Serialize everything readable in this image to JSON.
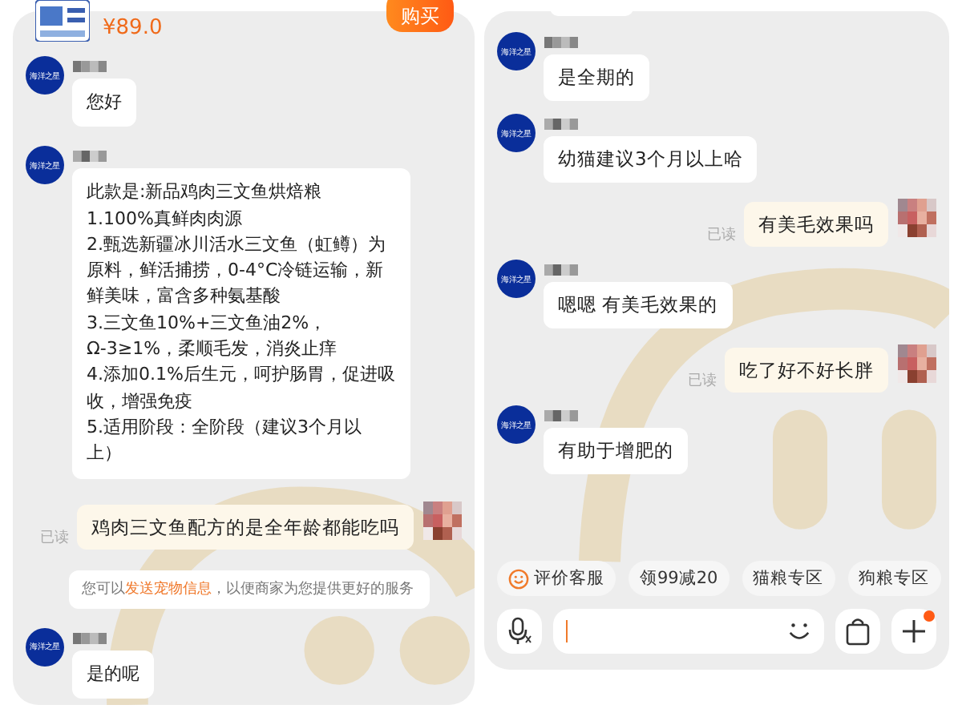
{
  "left_panel": {
    "product": {
      "price": "¥89.0",
      "buy_button": "购买"
    },
    "messages": [
      {
        "kind": "agent",
        "avatar_label": "海洋之星",
        "lines": [
          "您好"
        ]
      },
      {
        "kind": "agent",
        "avatar_label": "海洋之星",
        "lines": [
          "此款是:新品鸡肉三文鱼烘焙粮",
          "1.100%真鲜肉肉源",
          "2.甄选新疆冰川活水三文鱼（虹鳟）为原料，鲜活捕捞，0-4°C冷链运输，新鲜美味，富含多种氨基酸",
          "3.三文鱼10%+三文鱼油2%，Ω-3≥1%，柔顺毛发，消炎止痒",
          "4.添加0.1%后生元，呵护肠胃，促进吸收，增强免疫",
          "5.适用阶段：全阶段（建议3个月以上）"
        ]
      },
      {
        "kind": "user",
        "text": "鸡肉三文鱼配方的是全年龄都能吃吗",
        "status": "已读"
      },
      {
        "kind": "notice",
        "before": "您可以",
        "link": "发送宠物信息",
        "after": "，以便商家为您提供更好的服务"
      },
      {
        "kind": "agent",
        "avatar_label": "海洋之星",
        "lines": [
          "是的呢"
        ]
      }
    ]
  },
  "right_panel": {
    "messages": [
      {
        "kind": "agent",
        "avatar_label": "海洋之星",
        "lines": [
          "是全期的"
        ]
      },
      {
        "kind": "agent",
        "avatar_label": "海洋之星",
        "lines": [
          "幼猫建议3个月以上哈"
        ]
      },
      {
        "kind": "user",
        "text": "有美毛效果吗",
        "status": "已读"
      },
      {
        "kind": "agent",
        "avatar_label": "海洋之星",
        "lines": [
          "嗯嗯 有美毛效果的"
        ]
      },
      {
        "kind": "user",
        "text": "吃了好不好长胖",
        "status": "已读"
      },
      {
        "kind": "agent",
        "avatar_label": "海洋之星",
        "lines": [
          "有助于增肥的"
        ]
      }
    ],
    "quick_replies": [
      {
        "kind": "rating",
        "label": "评价客服"
      },
      {
        "kind": "plain",
        "label": "领99减20"
      },
      {
        "kind": "plain",
        "label": "猫粮专区"
      },
      {
        "kind": "plain",
        "label": "狗粮专区"
      }
    ]
  }
}
